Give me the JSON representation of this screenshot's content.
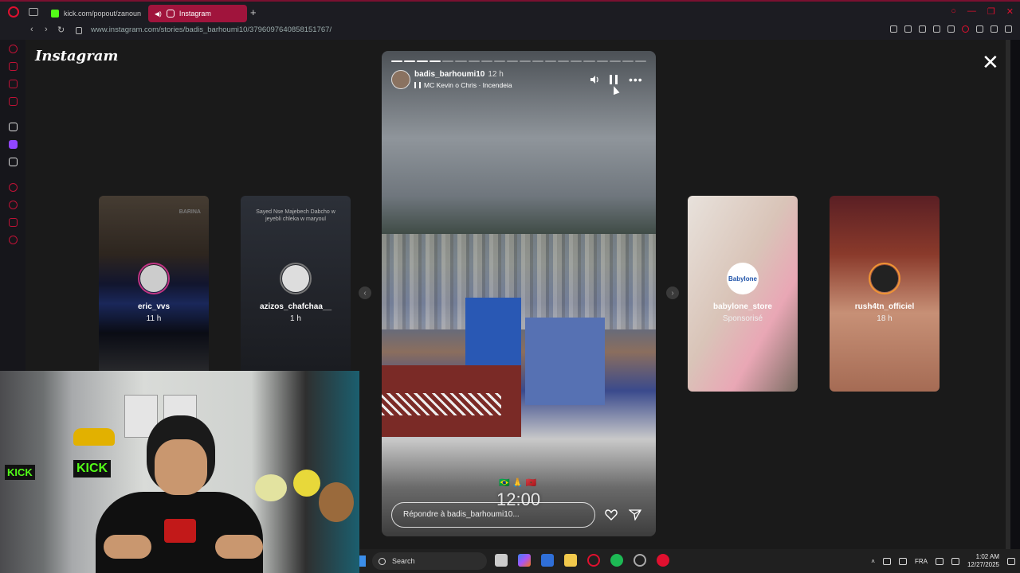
{
  "browser": {
    "tabs": [
      {
        "label": "kick.com/popout/zanoun"
      },
      {
        "label": "Instagram"
      }
    ],
    "new_tab": "+",
    "url": "www.instagram.com/stories/badis_barhoumi10/3796097640858151767/"
  },
  "instagram": {
    "logo": "Instagram",
    "close": "✕",
    "side_stories": [
      {
        "user": "eric_vvs",
        "time": "11 h",
        "overlay_text": "BARINA"
      },
      {
        "user": "azizos_chafchaa__",
        "time": "1 h",
        "overlay_text": "Sayed Nse Majebech Dabcho w jeyebli chleka w maryoul"
      },
      {
        "user": "babylone_store",
        "time": "Sponsorisé",
        "badge": "Babylone"
      },
      {
        "user": "rush4tn_officiel",
        "time": "18 h"
      }
    ],
    "story": {
      "user": "badis_barhoumi10",
      "time": "12 h",
      "music": "MC Kevin o Chris · Incendeia",
      "progress": {
        "total": 20,
        "done": 4
      },
      "time_sticker": "12:00",
      "flags": "🇧🇷 🙏 🇲🇦",
      "reply_placeholder": "Répondre à badis_barhoumi10..."
    }
  },
  "webcam": {
    "signs": [
      "KICK",
      "KICK"
    ]
  },
  "taskbar": {
    "search_label": "Search",
    "lang": "FRA",
    "time": "1:02 AM",
    "date": "12/27/2025"
  },
  "colors": {
    "accent": "#a0143c",
    "opera_red": "#e0102f",
    "kick_green": "#53fc18",
    "twitch_purple": "#9146ff"
  }
}
